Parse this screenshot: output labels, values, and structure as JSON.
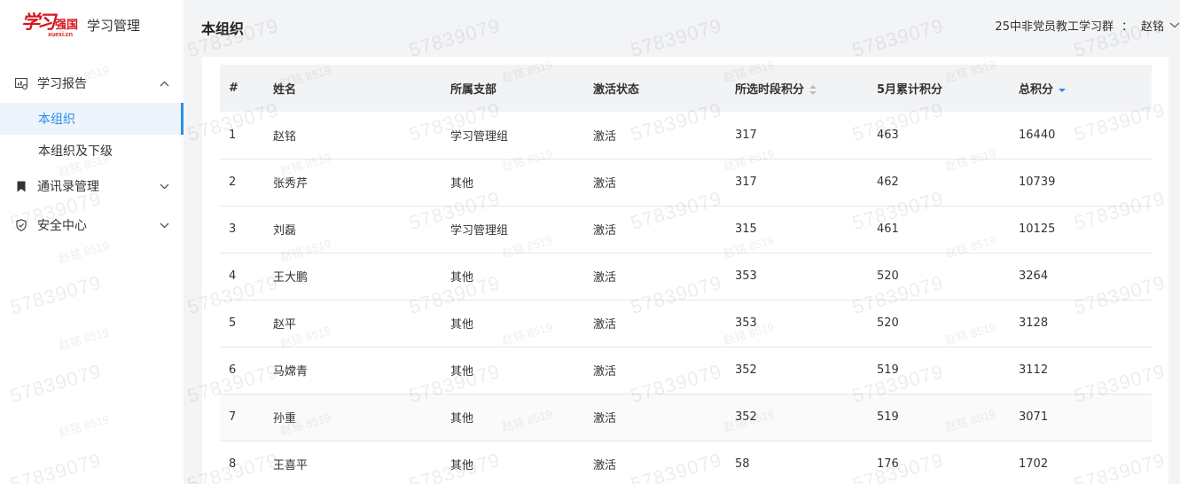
{
  "app": {
    "logo_text": "学习强国",
    "logo_url": "xuexi.cn",
    "title": "学习管理"
  },
  "sidebar": {
    "groups": [
      {
        "label": "学习报告",
        "icon": "report-icon",
        "expanded": true,
        "children": [
          {
            "label": "本组织",
            "active": true
          },
          {
            "label": "本组织及下级",
            "active": false
          }
        ]
      },
      {
        "label": "通讯录管理",
        "icon": "bookmark-icon",
        "expanded": false
      },
      {
        "label": "安全中心",
        "icon": "shield-icon",
        "expanded": false
      }
    ]
  },
  "header": {
    "page_title": "本组织",
    "group_name": "25中非党员教工学习群",
    "colon": "：",
    "user_name": "赵铭"
  },
  "table": {
    "columns": [
      "#",
      "姓名",
      "所属支部",
      "激活状态",
      "所选时段积分",
      "5月累计积分",
      "总积分"
    ],
    "rows": [
      [
        "1",
        "赵铭",
        "学习管理组",
        "激活",
        "317",
        "463",
        "16440"
      ],
      [
        "2",
        "张秀芹",
        "其他",
        "激活",
        "317",
        "462",
        "10739"
      ],
      [
        "3",
        "刘磊",
        "学习管理组",
        "激活",
        "315",
        "461",
        "10125"
      ],
      [
        "4",
        "王大鹏",
        "其他",
        "激活",
        "353",
        "520",
        "3264"
      ],
      [
        "5",
        "赵平",
        "其他",
        "激活",
        "353",
        "520",
        "3128"
      ],
      [
        "6",
        "马嫦青",
        "其他",
        "激活",
        "352",
        "519",
        "3112"
      ],
      [
        "7",
        "孙重",
        "其他",
        "激活",
        "352",
        "519",
        "3071"
      ],
      [
        "8",
        "王喜平",
        "其他",
        "激活",
        "58",
        "176",
        "1702"
      ]
    ],
    "sort": {
      "column": "总积分",
      "direction": "descending"
    }
  },
  "watermark": {
    "name": "赵铭 8519",
    "code": "57839079"
  },
  "colors": {
    "accent": "#2d8cf0",
    "brand": "#d4161d",
    "background": "#f3f4f6"
  }
}
